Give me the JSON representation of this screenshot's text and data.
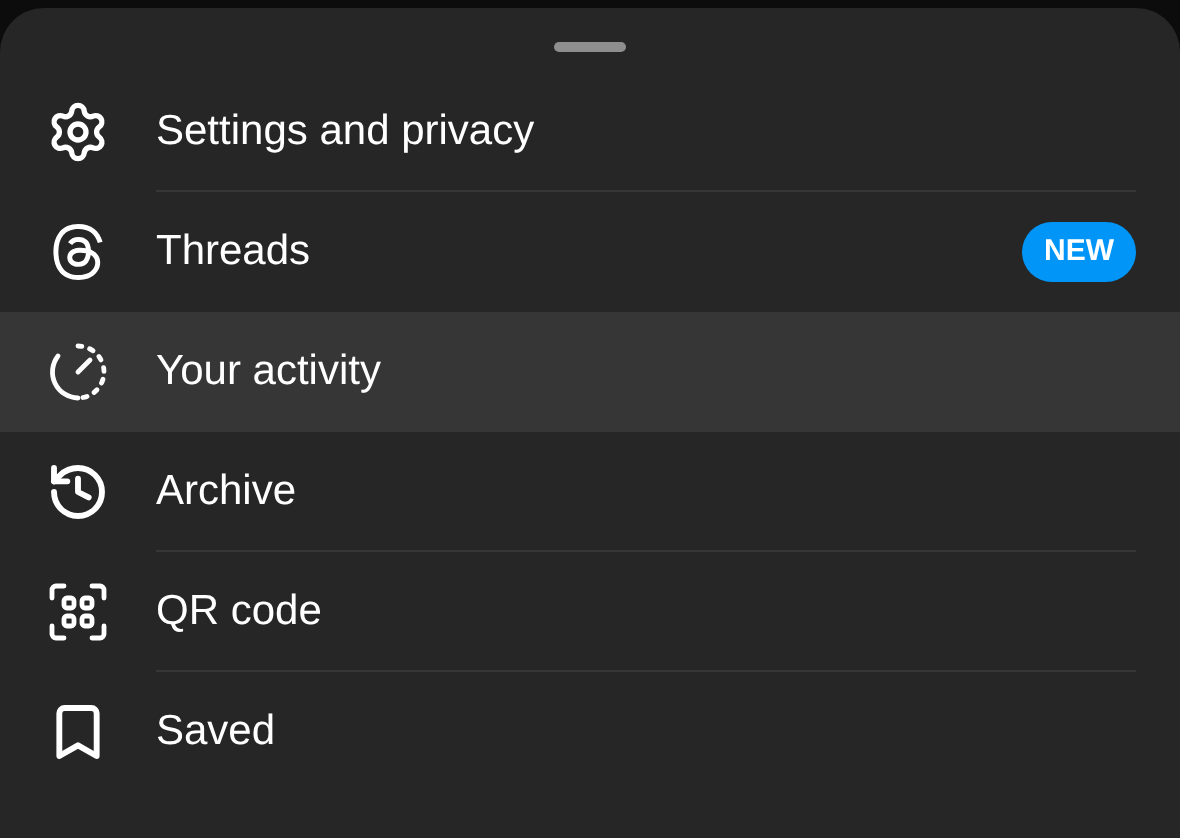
{
  "menu": {
    "items": [
      {
        "kind": "settings",
        "label": "Settings and privacy",
        "selected": false
      },
      {
        "kind": "threads",
        "label": "Threads",
        "selected": false,
        "badge": "NEW"
      },
      {
        "kind": "activity",
        "label": "Your activity",
        "selected": true
      },
      {
        "kind": "archive",
        "label": "Archive",
        "selected": false
      },
      {
        "kind": "qr",
        "label": "QR code",
        "selected": false
      },
      {
        "kind": "saved",
        "label": "Saved",
        "selected": false
      }
    ]
  }
}
